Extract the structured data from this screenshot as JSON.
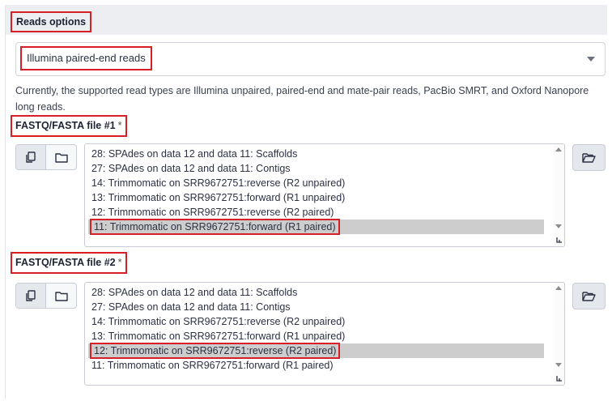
{
  "section": {
    "title": "Reads options"
  },
  "read_type": {
    "selected": "Illumina paired-end reads",
    "help": "Currently, the supported read types are Illumina unpaired, paired-end and mate-pair reads, PacBio SMRT, and Oxford Nanopore long reads."
  },
  "fields": [
    {
      "label": "FASTQ/FASTA file #1",
      "required_mark": "*",
      "options": [
        "28: SPAdes on data 12 and data 11: Scaffolds",
        "27: SPAdes on data 12 and data 11: Contigs",
        "14: Trimmomatic on SRR9672751:reverse (R2 unpaired)",
        "13: Trimmomatic on SRR9672751:forward (R1 unpaired)",
        "12: Trimmomatic on SRR9672751:reverse (R2 paired)",
        "11: Trimmomatic on SRR9672751:forward (R1 paired)"
      ],
      "selected_index": 5
    },
    {
      "label": "FASTQ/FASTA file #2",
      "required_mark": "*",
      "options": [
        "28: SPAdes on data 12 and data 11: Scaffolds",
        "27: SPAdes on data 12 and data 11: Contigs",
        "14: Trimmomatic on SRR9672751:reverse (R2 unpaired)",
        "13: Trimmomatic on SRR9672751:forward (R1 unpaired)",
        "12: Trimmomatic on SRR9672751:reverse (R2 paired)",
        "11: Trimmomatic on SRR9672751:forward (R1 paired)"
      ],
      "selected_index": 4
    }
  ],
  "icons": {
    "multiple": "copy-icon",
    "dataset": "folder-icon",
    "browse": "folder-open-icon",
    "caret": "caret-down-icon"
  },
  "colors": {
    "highlight_border": "#d71f27",
    "selected_row": "#cdcdcd",
    "header_bg": "#eceef2"
  }
}
